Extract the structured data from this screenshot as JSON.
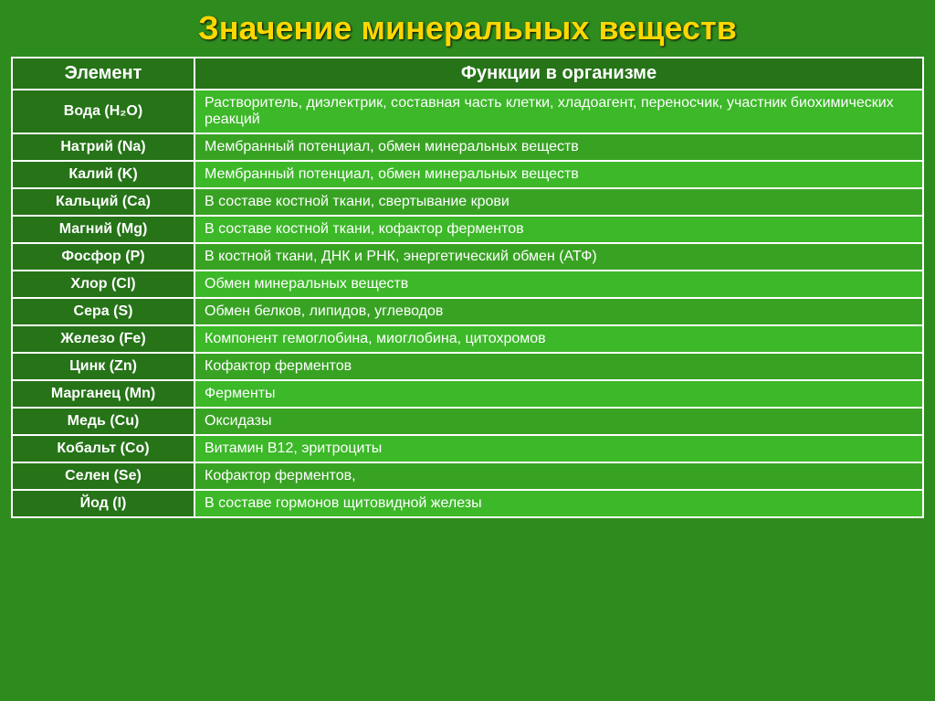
{
  "title": "Значение минеральных веществ",
  "table": {
    "headers": [
      "Элемент",
      "Функции в организме"
    ],
    "rows": [
      {
        "element": "Вода (H₂O)",
        "function": "Растворитель, диэлектрик, составная часть клетки, хладоагент, переносчик, участник биохимических реакций"
      },
      {
        "element": "Натрий (Na)",
        "function": "Мембранный потенциал, обмен минеральных веществ"
      },
      {
        "element": "Калий (K)",
        "function": "Мембранный потенциал, обмен минеральных веществ"
      },
      {
        "element": "Кальций (Ca)",
        "function": "В составе костной ткани, свертывание крови"
      },
      {
        "element": "Магний (Mg)",
        "function": "В составе костной ткани, кофактор ферментов"
      },
      {
        "element": "Фосфор (P)",
        "function": "В костной ткани,  ДНК и РНК, энергетический обмен  (АТФ)"
      },
      {
        "element": "Хлор (Cl)",
        "function": "Обмен минеральных веществ"
      },
      {
        "element": "Сера (S)",
        "function": "Обмен белков, липидов, углеводов"
      },
      {
        "element": "Железо (Fe)",
        "function": "Компонент гемоглобина, миоглобина, цитохромов"
      },
      {
        "element": "Цинк (Zn)",
        "function": "Кофактор ферментов"
      },
      {
        "element": "Марганец (Mn)",
        "function": "Ферменты"
      },
      {
        "element": "Медь (Cu)",
        "function": "Оксидазы"
      },
      {
        "element": "Кобальт (Co)",
        "function": "Витамин В12, эритроциты"
      },
      {
        "element": "Селен (Se)",
        "function": "Кофактор ферментов,"
      },
      {
        "element": "Йод (I)",
        "function": "В составе гормонов щитовидной железы"
      }
    ]
  }
}
